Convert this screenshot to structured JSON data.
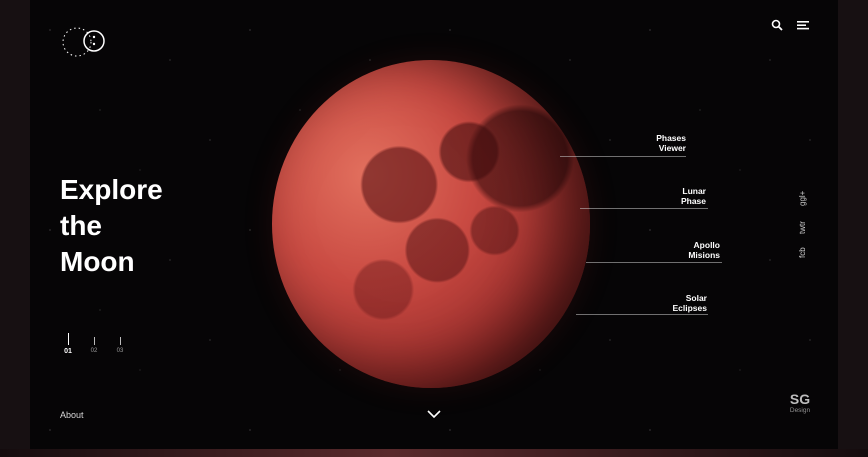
{
  "hero": {
    "line1": "Explore",
    "line2": "the",
    "line3": "Moon"
  },
  "menu": [
    {
      "line1": "Phases",
      "line2": "Viewer"
    },
    {
      "line1": "Lunar",
      "line2": "Phase"
    },
    {
      "line1": "Apollo",
      "line2": "Misions"
    },
    {
      "line1": "Solar",
      "line2": "Eclipses"
    }
  ],
  "pager": [
    {
      "label": "01",
      "active": true
    },
    {
      "label": "02",
      "active": false
    },
    {
      "label": "03",
      "active": false
    }
  ],
  "footer": {
    "about": "About"
  },
  "social": [
    "fcb",
    "twtr",
    "ggl+"
  ],
  "brand": {
    "mark": "SG",
    "sub": "Design"
  },
  "icons": {
    "logo": "moon-phase-logo",
    "search": "search-icon",
    "menu": "hamburger-icon",
    "scroll": "chevron-down-icon"
  },
  "colors": {
    "accent": "#c94a42",
    "background": "#060506",
    "text": "#ffffff"
  }
}
